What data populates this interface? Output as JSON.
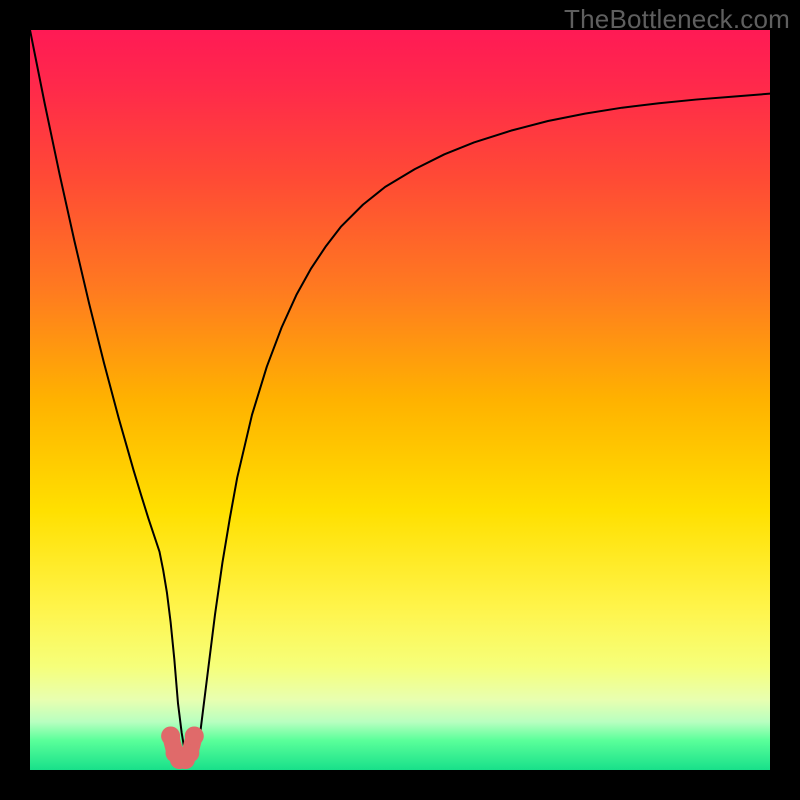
{
  "watermark": "TheBottleneck.com",
  "colors": {
    "frame": "#000000",
    "gradient_stops": [
      {
        "offset": 0.0,
        "color": "#ff1a55"
      },
      {
        "offset": 0.08,
        "color": "#ff2a4a"
      },
      {
        "offset": 0.2,
        "color": "#ff4a35"
      },
      {
        "offset": 0.35,
        "color": "#ff7a20"
      },
      {
        "offset": 0.5,
        "color": "#ffb200"
      },
      {
        "offset": 0.65,
        "color": "#ffe000"
      },
      {
        "offset": 0.78,
        "color": "#fff44a"
      },
      {
        "offset": 0.86,
        "color": "#f6ff7a"
      },
      {
        "offset": 0.905,
        "color": "#e8ffb0"
      },
      {
        "offset": 0.935,
        "color": "#b8ffc0"
      },
      {
        "offset": 0.96,
        "color": "#5aff9a"
      },
      {
        "offset": 1.0,
        "color": "#18e08a"
      }
    ],
    "curve": "#000000",
    "marker_fill": "#e06a6a",
    "marker_stroke": "#e06a6a"
  },
  "chart_data": {
    "type": "line",
    "title": "",
    "xlabel": "",
    "ylabel": "",
    "xlim": [
      0,
      100
    ],
    "ylim": [
      0,
      100
    ],
    "x": [
      0,
      2,
      4,
      6,
      8,
      10,
      12,
      14,
      15,
      16,
      17,
      17.5,
      18,
      18.5,
      19,
      19.5,
      20,
      20.5,
      21,
      21.5,
      22,
      22.5,
      23,
      24,
      25,
      26,
      27,
      28,
      30,
      32,
      34,
      36,
      38,
      40,
      42,
      45,
      48,
      52,
      56,
      60,
      65,
      70,
      75,
      80,
      85,
      90,
      95,
      100
    ],
    "y": [
      100,
      90,
      80.5,
      71.5,
      63,
      55,
      47.5,
      40.5,
      37.2,
      34,
      31,
      29.5,
      27,
      24,
      20,
      15,
      9,
      5,
      2,
      1.2,
      1.2,
      2,
      5,
      13,
      21,
      28,
      34,
      39.5,
      48,
      54.5,
      59.8,
      64.2,
      67.8,
      70.8,
      73.4,
      76.4,
      78.8,
      81.2,
      83.2,
      84.8,
      86.4,
      87.7,
      88.7,
      89.5,
      90.1,
      90.6,
      91,
      91.4
    ],
    "markers": {
      "x": [
        19,
        19.6,
        20.2,
        21,
        21.6,
        22.2
      ],
      "y": [
        4.6,
        2.3,
        1.4,
        1.4,
        2.3,
        4.6
      ]
    }
  }
}
